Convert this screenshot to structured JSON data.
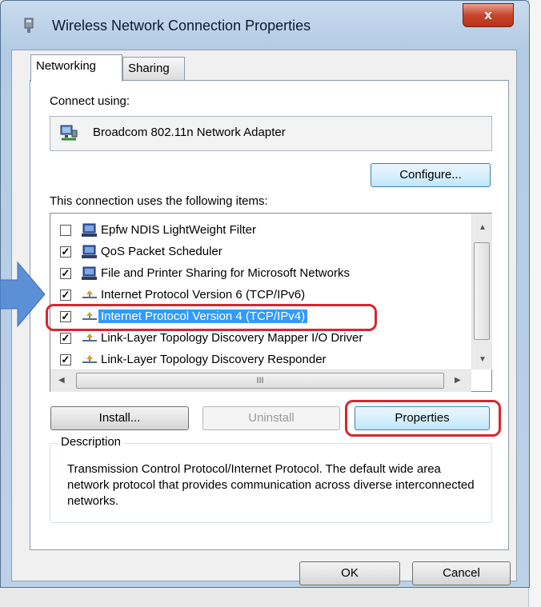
{
  "window": {
    "title": "Wireless Network Connection Properties",
    "close_label": "x"
  },
  "tabs": [
    {
      "label": "Networking",
      "active": true
    },
    {
      "label": "Sharing",
      "active": false
    }
  ],
  "connect_using": {
    "label": "Connect using:",
    "adapter": "Broadcom 802.11n Network Adapter",
    "configure_button": "Configure..."
  },
  "items": {
    "label": "This connection uses the following items:",
    "list": [
      {
        "checked": false,
        "icon": "network-service-icon",
        "label": "Epfw NDIS LightWeight Filter"
      },
      {
        "checked": true,
        "icon": "network-service-icon",
        "label": "QoS Packet Scheduler"
      },
      {
        "checked": true,
        "icon": "network-service-icon",
        "label": "File and Printer Sharing for Microsoft Networks"
      },
      {
        "checked": true,
        "icon": "protocol-icon",
        "label": "Internet Protocol Version 6 (TCP/IPv6)"
      },
      {
        "checked": true,
        "icon": "protocol-icon",
        "label": "Internet Protocol Version 4 (TCP/IPv4)",
        "selected": true
      },
      {
        "checked": true,
        "icon": "protocol-icon",
        "label": "Link-Layer Topology Discovery Mapper I/O Driver"
      },
      {
        "checked": true,
        "icon": "protocol-icon",
        "label": "Link-Layer Topology Discovery Responder"
      }
    ],
    "hscroll_grip": "III"
  },
  "buttons": {
    "install": "Install...",
    "uninstall": "Uninstall",
    "properties": "Properties",
    "ok": "OK",
    "cancel": "Cancel"
  },
  "description": {
    "legend": "Description",
    "text": "Transmission Control Protocol/Internet Protocol. The default wide area network protocol that provides communication across diverse interconnected networks."
  },
  "colors": {
    "selection": "#3399ff",
    "annotation": "#d7262f",
    "pointer_arrow": "#5b8fd6"
  }
}
